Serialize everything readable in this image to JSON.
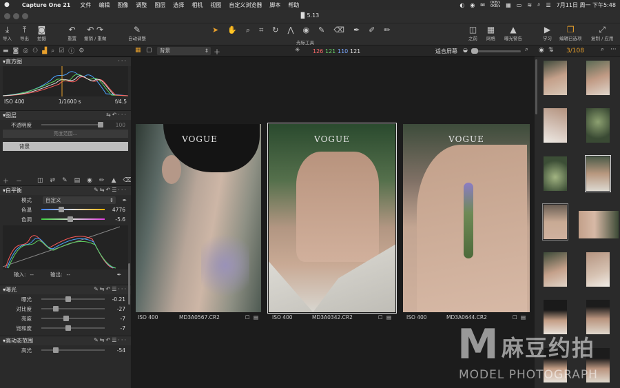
{
  "menubar": {
    "app": "Capture One 21",
    "items": [
      "文件",
      "编辑",
      "图像",
      "调整",
      "图层",
      "选择",
      "相机",
      "视图",
      "自定义浏览器",
      "脚本",
      "帮助"
    ],
    "net": "0KB/s\n0KB/s",
    "clock": "7月11日 周一 下午5:48"
  },
  "window": {
    "title": "5.13"
  },
  "toolbar": {
    "left": [
      {
        "icon": "⤓",
        "label": "导入"
      },
      {
        "icon": "⤒",
        "label": "导出"
      },
      {
        "icon": "◙",
        "label": "拍摄"
      },
      {
        "icon": "↶",
        "label": "重置"
      },
      {
        "icon": "↶ ↷",
        "label": "撤销 / 重做"
      },
      {
        "icon": "✎",
        "label": "自动调整"
      }
    ],
    "cursor_tools_label": "光标工具",
    "right": [
      {
        "icon": "◫",
        "label": "之前"
      },
      {
        "icon": "▦",
        "label": "网格"
      },
      {
        "icon": "▲",
        "label": "曝光警告"
      },
      {
        "icon": "▶",
        "label": "学习"
      },
      {
        "icon": "❐",
        "label": "编辑已选项"
      },
      {
        "icon": "⤢",
        "label": "复制 / 应用"
      }
    ]
  },
  "viewer": {
    "layer_select": "背景",
    "counts": {
      "r": "126",
      "g": "121",
      "b": "110",
      "l": "121"
    },
    "fit": "适合屏幕"
  },
  "browser": {
    "count": "3/108"
  },
  "histogram": {
    "title": "直方图",
    "iso": "ISO 400",
    "shutter": "1/1600 s",
    "aperture": "f/4.5"
  },
  "layers": {
    "title": "图层",
    "opacity_label": "不透明度",
    "opacity_value": "100",
    "range_button": "亮度范围...",
    "layer_name": "背景"
  },
  "wb": {
    "title": "白平衡",
    "mode_label": "模式",
    "mode_value": "自定义",
    "temp_label": "色温",
    "temp_value": "4776",
    "temp_level": 0.3,
    "tint_label": "色调",
    "tint_value": "-5.6",
    "tint_level": 0.45
  },
  "curve": {
    "input_label": "输入:",
    "input_value": "--",
    "output_label": "输出:",
    "output_value": "--"
  },
  "exposure": {
    "title": "曝光",
    "rows": [
      {
        "label": "曝光",
        "value": "-0.21",
        "level": 0.42
      },
      {
        "label": "对比度",
        "value": "-27",
        "level": 0.2
      },
      {
        "label": "亮度",
        "value": "-7",
        "level": 0.38
      },
      {
        "label": "饱和度",
        "value": "-7",
        "level": 0.42
      }
    ]
  },
  "hdr": {
    "title": "高动态范围",
    "rows": [
      {
        "label": "高光",
        "value": "-54",
        "level": 0.2
      }
    ]
  },
  "photos": [
    {
      "watermark": "VOGUE",
      "iso": "ISO 400",
      "name": "MD3A0567.CR2"
    },
    {
      "watermark": "VOGUE",
      "iso": "ISO 400",
      "name": "MD3A0342.CR2"
    },
    {
      "watermark": "VOGUE",
      "iso": "ISO 400",
      "name": "MD3A0644.CR2"
    }
  ],
  "overlay": {
    "letter": "M",
    "cn": "麻豆约拍",
    "en": "MODEL PHOTOGRAPH"
  },
  "colors": {
    "accent": "#e8a02c"
  }
}
